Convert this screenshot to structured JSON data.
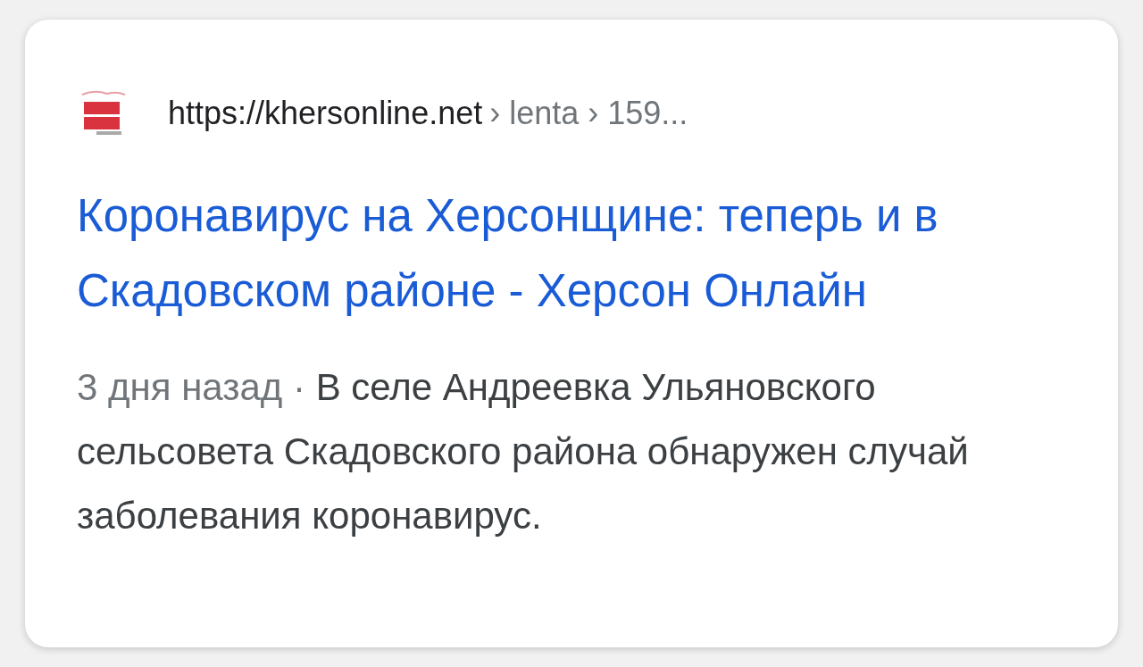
{
  "result": {
    "url": "https://khersonline.net",
    "breadcrumb": "› lenta › 159...",
    "title": "Коронавирус на Херсонщине: теперь и в Скадовском районе - Херсон Онлайн",
    "date": "3 дня назад ·",
    "snippet": "В селе Андреевка Ульяновского сельсовета Скадовского района обнаружен случай заболевания коронавирус."
  }
}
